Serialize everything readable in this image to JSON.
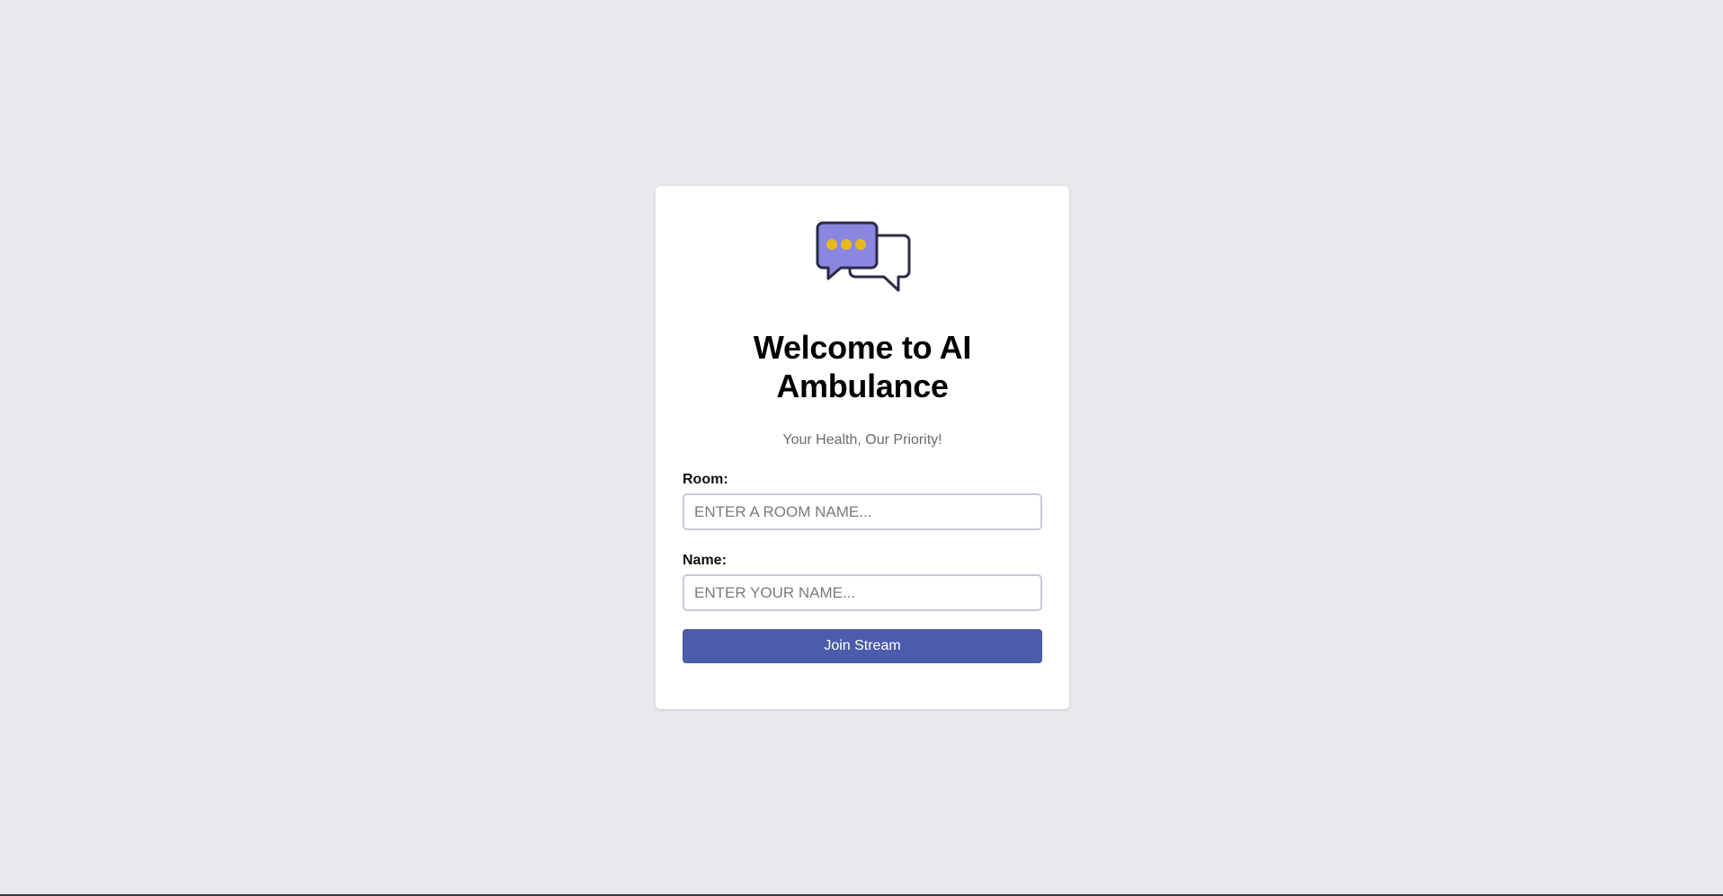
{
  "app": {
    "title": [
      "Welcome to AI",
      "Ambulance"
    ],
    "subtitle": "Your Health, Our Priority!",
    "logo_icon": "chat-bubbles-icon"
  },
  "form": {
    "room_label": "Room:",
    "room_placeholder": "ENTER A ROOM NAME...",
    "room_value": "",
    "name_label": "Name:",
    "name_placeholder": "ENTER YOUR NAME...",
    "name_value": "",
    "submit_label": "Join Stream"
  },
  "colors": {
    "background": "#e8e9ee",
    "card": "#ffffff",
    "button": "#4c5cad",
    "bubble_fill": "#8b87e0",
    "bubble_dots": "#e8b820",
    "bubble_stroke": "#2b2b45"
  }
}
